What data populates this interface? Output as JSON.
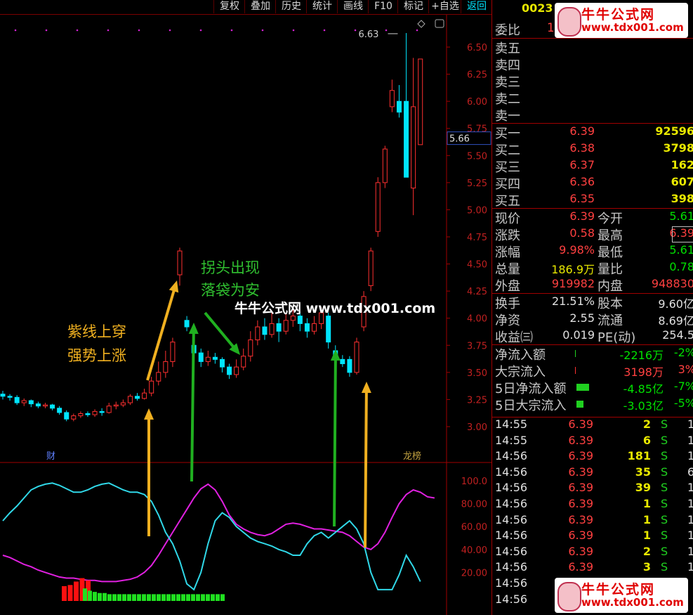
{
  "toolbar": {
    "items": [
      "复权",
      "叠加",
      "历史",
      "统计",
      "画线",
      "F10",
      "标记",
      "+自选",
      "返回"
    ]
  },
  "chart": {
    "price_labels": [
      "6.50",
      "6.25",
      "6.00",
      "5.75",
      "5.50",
      "5.25",
      "5.00",
      "4.75",
      "4.50",
      "4.25",
      "4.00",
      "3.75",
      "3.50",
      "3.25",
      "3.00"
    ],
    "current_price_tag": "5.66",
    "high_label": "6.63",
    "cai_badge": "财",
    "longhu_badge": "龙榜",
    "annotation_left_1": "紫线上穿",
    "annotation_left_2": "强势上涨",
    "annotation_right_1": "拐头出现",
    "annotation_right_2": "落袋为安",
    "center_watermark": "牛牛公式网 www.tdx001.com",
    "indicator_labels": [
      "100.0",
      "80.00",
      "60.00",
      "40.00",
      "20.00"
    ],
    "colors": {
      "up": "#ff3030",
      "down": "#00e5ff",
      "purple": "#e020e0",
      "cyan": "#30d8e8",
      "orange": "#f0b020",
      "green": "#20b020"
    }
  },
  "chart_data": {
    "type": "line",
    "price_axis": {
      "min": 3.0,
      "max": 6.5
    },
    "indicator_axis": {
      "min": 0,
      "max": 100
    },
    "candles": [
      {
        "o": 3.3,
        "c": 3.28,
        "h": 3.33,
        "l": 3.25
      },
      {
        "o": 3.28,
        "c": 3.27,
        "h": 3.3,
        "l": 3.24
      },
      {
        "o": 3.27,
        "c": 3.22,
        "h": 3.29,
        "l": 3.2
      },
      {
        "o": 3.22,
        "c": 3.24,
        "h": 3.26,
        "l": 3.19
      },
      {
        "o": 3.24,
        "c": 3.21,
        "h": 3.25,
        "l": 3.18
      },
      {
        "o": 3.21,
        "c": 3.19,
        "h": 3.23,
        "l": 3.17
      },
      {
        "o": 3.19,
        "c": 3.2,
        "h": 3.22,
        "l": 3.17
      },
      {
        "o": 3.2,
        "c": 3.17,
        "h": 3.21,
        "l": 3.15
      },
      {
        "o": 3.17,
        "c": 3.13,
        "h": 3.19,
        "l": 3.11
      },
      {
        "o": 3.13,
        "c": 3.07,
        "h": 3.15,
        "l": 3.05
      },
      {
        "o": 3.07,
        "c": 3.1,
        "h": 3.12,
        "l": 3.05
      },
      {
        "o": 3.1,
        "c": 3.12,
        "h": 3.14,
        "l": 3.08
      },
      {
        "o": 3.12,
        "c": 3.11,
        "h": 3.14,
        "l": 3.09
      },
      {
        "o": 3.11,
        "c": 3.14,
        "h": 3.16,
        "l": 3.09
      },
      {
        "o": 3.14,
        "c": 3.13,
        "h": 3.17,
        "l": 3.1
      },
      {
        "o": 3.13,
        "c": 3.19,
        "h": 3.22,
        "l": 3.12
      },
      {
        "o": 3.19,
        "c": 3.2,
        "h": 3.23,
        "l": 3.16
      },
      {
        "o": 3.2,
        "c": 3.22,
        "h": 3.25,
        "l": 3.18
      },
      {
        "o": 3.22,
        "c": 3.28,
        "h": 3.3,
        "l": 3.2
      },
      {
        "o": 3.28,
        "c": 3.26,
        "h": 3.31,
        "l": 3.24
      },
      {
        "o": 3.26,
        "c": 3.31,
        "h": 3.35,
        "l": 3.25
      },
      {
        "o": 3.31,
        "c": 3.42,
        "h": 3.46,
        "l": 3.28
      },
      {
        "o": 3.42,
        "c": 3.5,
        "h": 3.6,
        "l": 3.38
      },
      {
        "o": 3.5,
        "c": 3.6,
        "h": 3.7,
        "l": 3.45
      },
      {
        "o": 3.6,
        "c": 3.78,
        "h": 3.82,
        "l": 3.55
      },
      {
        "o": 4.4,
        "c": 4.62,
        "h": 4.65,
        "l": 4.3
      },
      {
        "o": 3.98,
        "c": 3.92,
        "h": 4.02,
        "l": 3.88
      },
      {
        "o": 3.75,
        "c": 3.68,
        "h": 3.82,
        "l": 3.62
      },
      {
        "o": 3.68,
        "c": 3.6,
        "h": 3.72,
        "l": 3.55
      },
      {
        "o": 3.6,
        "c": 3.64,
        "h": 3.7,
        "l": 3.56
      },
      {
        "o": 3.64,
        "c": 3.62,
        "h": 3.68,
        "l": 3.58
      },
      {
        "o": 3.62,
        "c": 3.55,
        "h": 3.64,
        "l": 3.5
      },
      {
        "o": 3.55,
        "c": 3.48,
        "h": 3.58,
        "l": 3.44
      },
      {
        "o": 3.48,
        "c": 3.55,
        "h": 3.62,
        "l": 3.45
      },
      {
        "o": 3.55,
        "c": 3.65,
        "h": 3.72,
        "l": 3.52
      },
      {
        "o": 3.65,
        "c": 3.8,
        "h": 3.88,
        "l": 3.6
      },
      {
        "o": 3.8,
        "c": 3.92,
        "h": 3.98,
        "l": 3.75
      },
      {
        "o": 3.92,
        "c": 3.85,
        "h": 4.0,
        "l": 3.8
      },
      {
        "o": 3.85,
        "c": 3.95,
        "h": 4.05,
        "l": 3.82
      },
      {
        "o": 3.95,
        "c": 3.88,
        "h": 4.0,
        "l": 3.78
      },
      {
        "o": 3.88,
        "c": 3.98,
        "h": 4.05,
        "l": 3.85
      },
      {
        "o": 3.98,
        "c": 4.02,
        "h": 4.08,
        "l": 3.92
      },
      {
        "o": 4.02,
        "c": 3.95,
        "h": 4.06,
        "l": 3.88
      },
      {
        "o": 3.95,
        "c": 3.88,
        "h": 4.0,
        "l": 3.82
      },
      {
        "o": 3.88,
        "c": 3.95,
        "h": 4.02,
        "l": 3.85
      },
      {
        "o": 3.95,
        "c": 4.05,
        "h": 4.1,
        "l": 3.9
      },
      {
        "o": 4.02,
        "c": 3.78,
        "h": 4.05,
        "l": 3.72
      },
      {
        "o": 3.7,
        "c": 3.62,
        "h": 3.75,
        "l": 3.58
      },
      {
        "o": 3.62,
        "c": 3.58,
        "h": 3.66,
        "l": 3.55
      },
      {
        "o": 3.62,
        "c": 3.5,
        "h": 3.65,
        "l": 3.46
      },
      {
        "o": 3.5,
        "c": 3.78,
        "h": 3.82,
        "l": 3.48
      },
      {
        "o": 3.92,
        "c": 4.2,
        "h": 4.25,
        "l": 3.88
      },
      {
        "o": 4.3,
        "c": 4.62,
        "h": 4.65,
        "l": 4.25
      },
      {
        "o": 4.8,
        "c": 5.25,
        "h": 5.3,
        "l": 4.75
      },
      {
        "o": 5.25,
        "c": 5.56,
        "h": 5.59,
        "l": 5.2
      },
      {
        "o": 5.95,
        "c": 6.1,
        "h": 6.2,
        "l": 5.9
      },
      {
        "o": 6.0,
        "c": 5.9,
        "h": 6.15,
        "l": 5.85
      },
      {
        "o": 6.0,
        "c": 5.3,
        "h": 6.63,
        "l": 5.3
      },
      {
        "o": 5.2,
        "c": 5.95,
        "h": 6.4,
        "l": 4.95
      },
      {
        "o": 5.6,
        "c": 6.39,
        "h": 6.39,
        "l": 5.6
      }
    ],
    "ind_purple": [
      35,
      33,
      30,
      27,
      25,
      22,
      20,
      18,
      16,
      15,
      15,
      14,
      13,
      13,
      12,
      12,
      12,
      13,
      14,
      16,
      20,
      26,
      35,
      45,
      55,
      65,
      75,
      85,
      93,
      97,
      92,
      82,
      70,
      62,
      58,
      55,
      53,
      52,
      54,
      58,
      62,
      63,
      62,
      60,
      58,
      58,
      57,
      56,
      55,
      52,
      47,
      42,
      40,
      45,
      55,
      68,
      80,
      88,
      92,
      90,
      86,
      85
    ],
    "ind_cyan": [
      65,
      72,
      78,
      85,
      92,
      95,
      97,
      98,
      96,
      93,
      90,
      90,
      92,
      95,
      97,
      98,
      95,
      92,
      90,
      90,
      88,
      82,
      70,
      55,
      45,
      30,
      10,
      5,
      20,
      45,
      65,
      72,
      68,
      60,
      55,
      50,
      47,
      45,
      43,
      40,
      38,
      35,
      35,
      45,
      52,
      55,
      50,
      55,
      60,
      65,
      58,
      45,
      20,
      5,
      5,
      5,
      18,
      35,
      25,
      12
    ],
    "vol_red": [
      8,
      9,
      12,
      15,
      13,
      0,
      0,
      0
    ],
    "vol_green": [
      6,
      4,
      3,
      2,
      2,
      1,
      1,
      1,
      1,
      1,
      1,
      1,
      1,
      1,
      1,
      1,
      1,
      1,
      1,
      1,
      1,
      1,
      1,
      1,
      1,
      1,
      1,
      1,
      1
    ]
  },
  "quote": {
    "code_partial": "0023",
    "code_num": "1",
    "weibi_label": "委比",
    "sell": [
      {
        "label": "卖五"
      },
      {
        "label": "卖四"
      },
      {
        "label": "卖三"
      },
      {
        "label": "卖二"
      },
      {
        "label": "卖一"
      }
    ],
    "buy": [
      {
        "label": "买一",
        "price": "6.39",
        "vol": "92596"
      },
      {
        "label": "买二",
        "price": "6.38",
        "vol": "3798"
      },
      {
        "label": "买三",
        "price": "6.37",
        "vol": "162"
      },
      {
        "label": "买四",
        "price": "6.36",
        "vol": "607"
      },
      {
        "label": "买五",
        "price": "6.35",
        "vol": "398"
      }
    ],
    "stats1": [
      {
        "l1": "现价",
        "v1": "6.39",
        "l2": "今开",
        "v2": "5.61"
      },
      {
        "l1": "涨跌",
        "v1": "0.58",
        "l2": "最高",
        "v2": "6.39"
      },
      {
        "l1": "涨幅",
        "v1": "9.98%",
        "l2": "最低",
        "v2": "5.61"
      },
      {
        "l1": "总量",
        "v1": "186.9万",
        "l2": "量比",
        "v2": "0.78"
      },
      {
        "l1": "外盘",
        "v1": "919982",
        "l2": "内盘",
        "v2": "948830"
      }
    ],
    "stats2": [
      {
        "l1": "换手",
        "v1": "21.51%",
        "l2": "股本",
        "v2": "9.60亿"
      },
      {
        "l1": "净资",
        "v1": "2.55",
        "l2": "流通",
        "v2": "8.69亿"
      },
      {
        "l1": "收益㈢",
        "v1": "0.019",
        "l2": "PE(动)",
        "v2": "254.5"
      }
    ],
    "flows": [
      {
        "label": "净流入额",
        "val": "-2216万",
        "pct": "-2%"
      },
      {
        "label": "大宗流入",
        "val": "3198万",
        "pct": "3%"
      },
      {
        "label": "5日净流入额",
        "val": "-4.85亿",
        "pct": "-7%"
      },
      {
        "label": "5日大宗流入",
        "val": "-3.03亿",
        "pct": "-5%"
      }
    ],
    "ticks": [
      {
        "time": "14:55",
        "price": "6.39",
        "vol": "2",
        "bs": "S"
      },
      {
        "time": "14:55",
        "price": "6.39",
        "vol": "6",
        "bs": "S"
      },
      {
        "time": "14:56",
        "price": "6.39",
        "vol": "181",
        "bs": "S"
      },
      {
        "time": "14:56",
        "price": "6.39",
        "vol": "35",
        "bs": "S"
      },
      {
        "time": "14:56",
        "price": "6.39",
        "vol": "39",
        "bs": "S"
      },
      {
        "time": "14:56",
        "price": "6.39",
        "vol": "1",
        "bs": "S"
      },
      {
        "time": "14:56",
        "price": "6.39",
        "vol": "1",
        "bs": "S"
      },
      {
        "time": "14:56",
        "price": "6.39",
        "vol": "1",
        "bs": "S"
      },
      {
        "time": "14:56",
        "price": "6.39",
        "vol": "2",
        "bs": "S"
      },
      {
        "time": "14:56",
        "price": "6.39",
        "vol": "3",
        "bs": "S"
      },
      {
        "time": "14:56",
        "price": "",
        "vol": "",
        "bs": ""
      },
      {
        "time": "14:56",
        "price": "",
        "vol": "",
        "bs": ""
      }
    ],
    "tick_extra": [
      "1",
      "1",
      "1",
      "6",
      "1",
      "1",
      "1",
      "1",
      "1",
      "1",
      "",
      ""
    ]
  },
  "watermark": {
    "title": "牛牛公式网",
    "url": "www.tdx001.com"
  }
}
